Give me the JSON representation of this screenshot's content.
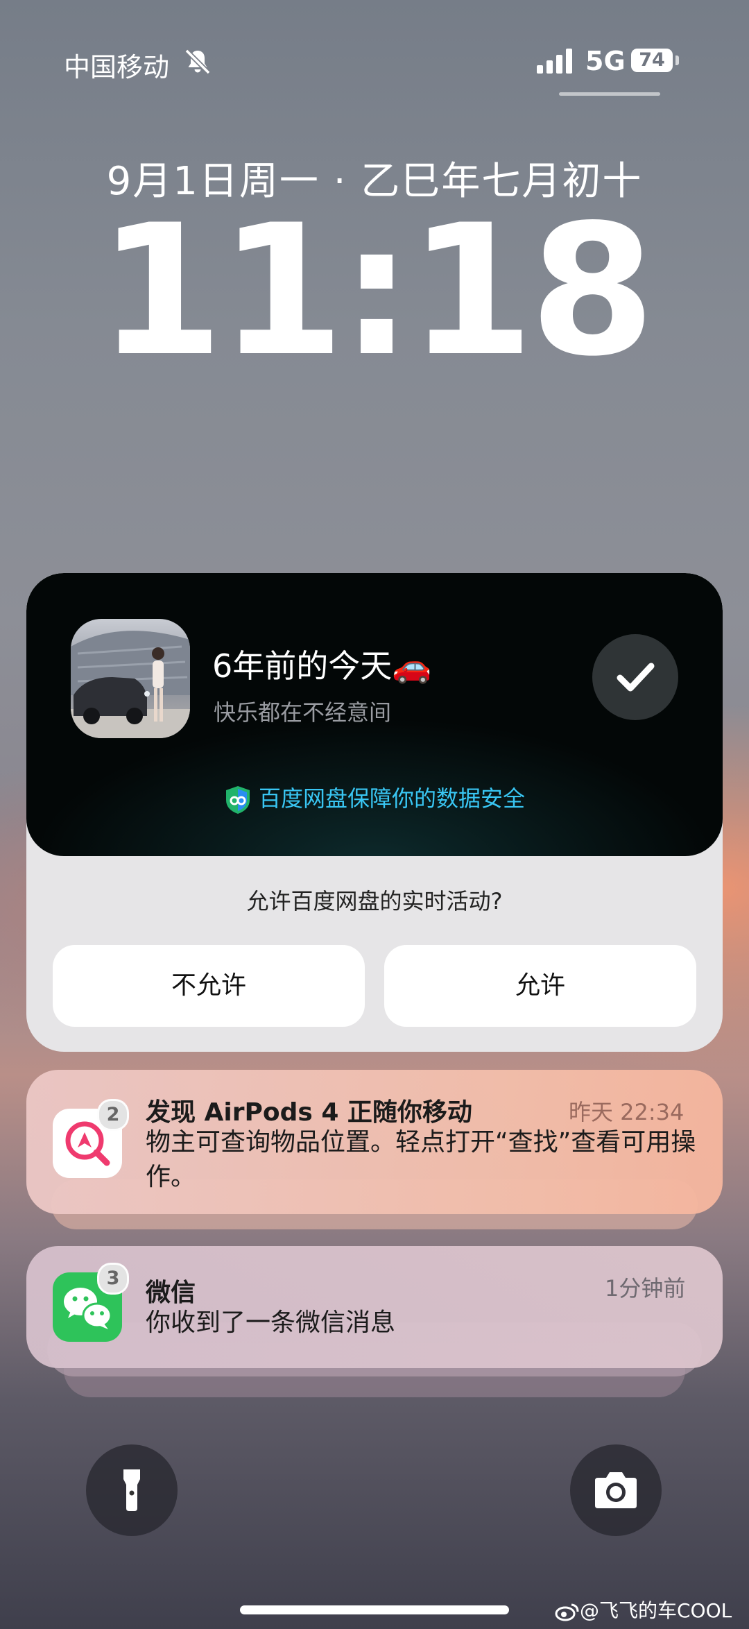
{
  "status_bar": {
    "carrier": "中国移动",
    "mute_icon": "bell-slash-icon",
    "signal_icon": "cellular-signal-icon",
    "network": "5G",
    "battery": "74"
  },
  "lock_screen": {
    "date": "9月1日周一 · 乙巳年七月初十",
    "time": "11:18"
  },
  "live_activity": {
    "title": "6年前的今天🚗",
    "subtitle": "快乐都在不经意间",
    "security_text": "百度网盘保障你的数据安全",
    "prompt": "允许百度网盘的实时活动?",
    "deny_label": "不允许",
    "allow_label": "允许",
    "colors": {
      "accent": "#39c6f3",
      "dark_bg": "#030606"
    }
  },
  "notifications": [
    {
      "app_icon": "find-my-icon",
      "badge": "2",
      "title": "发现 AirPods 4 正随你移动",
      "body": "物主可查询物品位置。轻点打开“查找”查看可用操作。",
      "time": "昨天 22:34"
    },
    {
      "app_icon": "wechat-icon",
      "badge": "3",
      "title": "微信",
      "body": "你收到了一条微信消息",
      "time": "1分钟前"
    }
  ],
  "quick_actions": {
    "left_icon": "flashlight-icon",
    "right_icon": "camera-icon"
  },
  "watermark": "@飞飞的车COOL"
}
